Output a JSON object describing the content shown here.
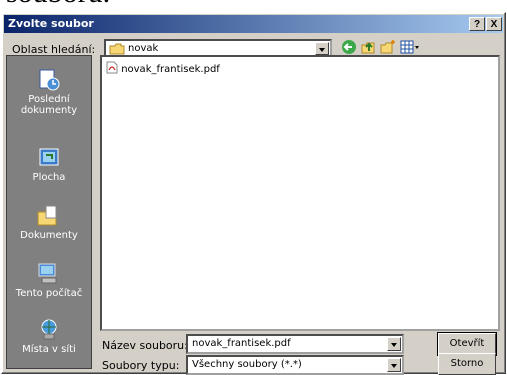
{
  "background_text": "souboru.",
  "window": {
    "title": "Zvolte soubor",
    "help_label": "?",
    "close_label": "X"
  },
  "lookin": {
    "label": "Oblast hledání:",
    "value": "novak"
  },
  "toolbar": {
    "back_icon": "back-arrow-icon",
    "up_icon": "up-folder-icon",
    "newfolder_icon": "new-folder-icon",
    "views_icon": "views-menu-icon"
  },
  "places": [
    {
      "label": "Poslední dokumenty",
      "icon": "recent-documents-icon"
    },
    {
      "label": "Plocha",
      "icon": "desktop-icon"
    },
    {
      "label": "Dokumenty",
      "icon": "my-documents-icon"
    },
    {
      "label": "Tento počítač",
      "icon": "my-computer-icon"
    },
    {
      "label": "Místa v síti",
      "icon": "network-places-icon"
    }
  ],
  "files": [
    {
      "name": "novak_frantisek.pdf",
      "icon": "pdf-file-icon"
    }
  ],
  "filename": {
    "label": "Název souboru:",
    "value": "novak_frantisek.pdf"
  },
  "filetype": {
    "label": "Soubory typu:",
    "value": "Všechny soubory (*.*)"
  },
  "buttons": {
    "open": "Otevřít",
    "cancel": "Storno"
  },
  "colors": {
    "titlebar_start": "#0a246a",
    "titlebar_end": "#a6caf0",
    "face": "#d4d0c8",
    "places_bg": "#808080"
  }
}
